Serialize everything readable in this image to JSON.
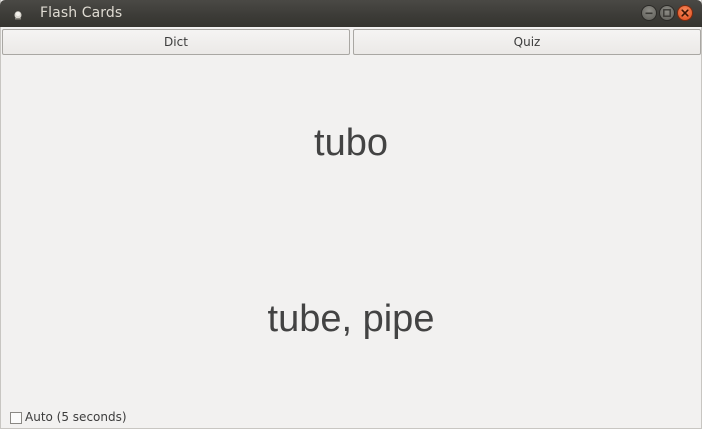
{
  "window": {
    "title": "Flash Cards",
    "icon": "app-icon",
    "controls": [
      "minimize-icon",
      "maximize-icon",
      "close-icon"
    ]
  },
  "tabs": [
    {
      "label": "Dict"
    },
    {
      "label": "Quiz"
    }
  ],
  "card": {
    "word": "tubo",
    "translation": "tube, pipe"
  },
  "auto": {
    "label": "Auto (5 seconds)",
    "checked": false
  },
  "colors": {
    "titlebar": "#3c3b37",
    "title_text": "#dfdbd2",
    "close_button": "#e95420",
    "background": "#f2f1f0",
    "card_text": "#434343"
  }
}
